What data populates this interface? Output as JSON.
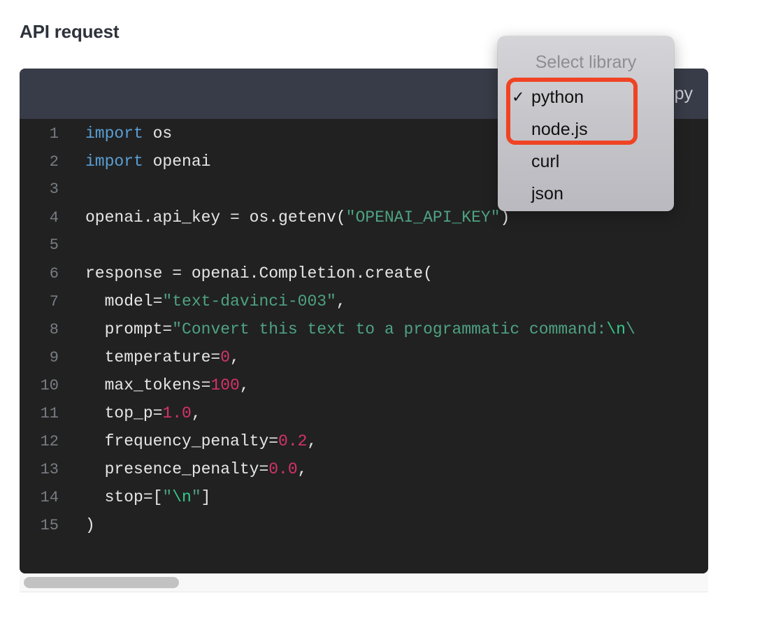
{
  "page": {
    "title": "API request",
    "background_color": "#ffffff"
  },
  "code_card": {
    "header": {
      "copy_label": "Copy"
    },
    "theme": {
      "header_bg": "#383c48",
      "body_bg": "#212121",
      "keyword_color": "#5a9fd4",
      "string_color": "#4ea283",
      "escape_color": "#35c98b",
      "number_color": "#d6336c",
      "plain_color": "#e6e6e6",
      "line_number_color": "#787d84"
    },
    "lines": [
      {
        "n": "1",
        "tokens": [
          {
            "t": "import",
            "c": "kw"
          },
          {
            "t": " os",
            "c": "plain"
          }
        ]
      },
      {
        "n": "2",
        "tokens": [
          {
            "t": "import",
            "c": "kw"
          },
          {
            "t": " openai",
            "c": "plain"
          }
        ]
      },
      {
        "n": "3",
        "tokens": []
      },
      {
        "n": "4",
        "tokens": [
          {
            "t": "openai.api_key = os.getenv(",
            "c": "plain"
          },
          {
            "t": "\"OPENAI_API_KEY\"",
            "c": "str"
          },
          {
            "t": ")",
            "c": "plain"
          }
        ]
      },
      {
        "n": "5",
        "tokens": []
      },
      {
        "n": "6",
        "tokens": [
          {
            "t": "response = openai.Completion.create(",
            "c": "plain"
          }
        ]
      },
      {
        "n": "7",
        "tokens": [
          {
            "t": "  model=",
            "c": "plain"
          },
          {
            "t": "\"text-davinci-003\"",
            "c": "str"
          },
          {
            "t": ",",
            "c": "plain"
          }
        ]
      },
      {
        "n": "8",
        "tokens": [
          {
            "t": "  prompt=",
            "c": "plain"
          },
          {
            "t": "\"Convert this text to a programmatic command:",
            "c": "str"
          },
          {
            "t": "\\n",
            "c": "esc"
          },
          {
            "t": "\\",
            "c": "str"
          }
        ]
      },
      {
        "n": "9",
        "tokens": [
          {
            "t": "  temperature=",
            "c": "plain"
          },
          {
            "t": "0",
            "c": "num"
          },
          {
            "t": ",",
            "c": "plain"
          }
        ]
      },
      {
        "n": "10",
        "tokens": [
          {
            "t": "  max_tokens=",
            "c": "plain"
          },
          {
            "t": "100",
            "c": "num"
          },
          {
            "t": ",",
            "c": "plain"
          }
        ]
      },
      {
        "n": "11",
        "tokens": [
          {
            "t": "  top_p=",
            "c": "plain"
          },
          {
            "t": "1.0",
            "c": "num"
          },
          {
            "t": ",",
            "c": "plain"
          }
        ]
      },
      {
        "n": "12",
        "tokens": [
          {
            "t": "  frequency_penalty=",
            "c": "plain"
          },
          {
            "t": "0.2",
            "c": "num"
          },
          {
            "t": ",",
            "c": "plain"
          }
        ]
      },
      {
        "n": "13",
        "tokens": [
          {
            "t": "  presence_penalty=",
            "c": "plain"
          },
          {
            "t": "0.0",
            "c": "num"
          },
          {
            "t": ",",
            "c": "plain"
          }
        ]
      },
      {
        "n": "14",
        "tokens": [
          {
            "t": "  stop=[",
            "c": "plain"
          },
          {
            "t": "\"",
            "c": "str"
          },
          {
            "t": "\\n",
            "c": "esc"
          },
          {
            "t": "\"",
            "c": "str"
          },
          {
            "t": "]",
            "c": "plain"
          }
        ]
      },
      {
        "n": "15",
        "tokens": [
          {
            "t": ")",
            "c": "plain"
          }
        ]
      }
    ]
  },
  "scrollbar": {
    "orientation": "horizontal",
    "thumb_color": "#c2c2c2",
    "track_color": "#f8f8f8"
  },
  "dropdown": {
    "header_label": "Select library",
    "selected": "python",
    "check_glyph": "✓",
    "items": [
      {
        "label": "python",
        "selected": true
      },
      {
        "label": "node.js",
        "selected": false
      },
      {
        "label": "curl",
        "selected": false
      },
      {
        "label": "json",
        "selected": false
      }
    ]
  },
  "annotation": {
    "color": "#f04323",
    "shape": "rounded-rectangle"
  }
}
